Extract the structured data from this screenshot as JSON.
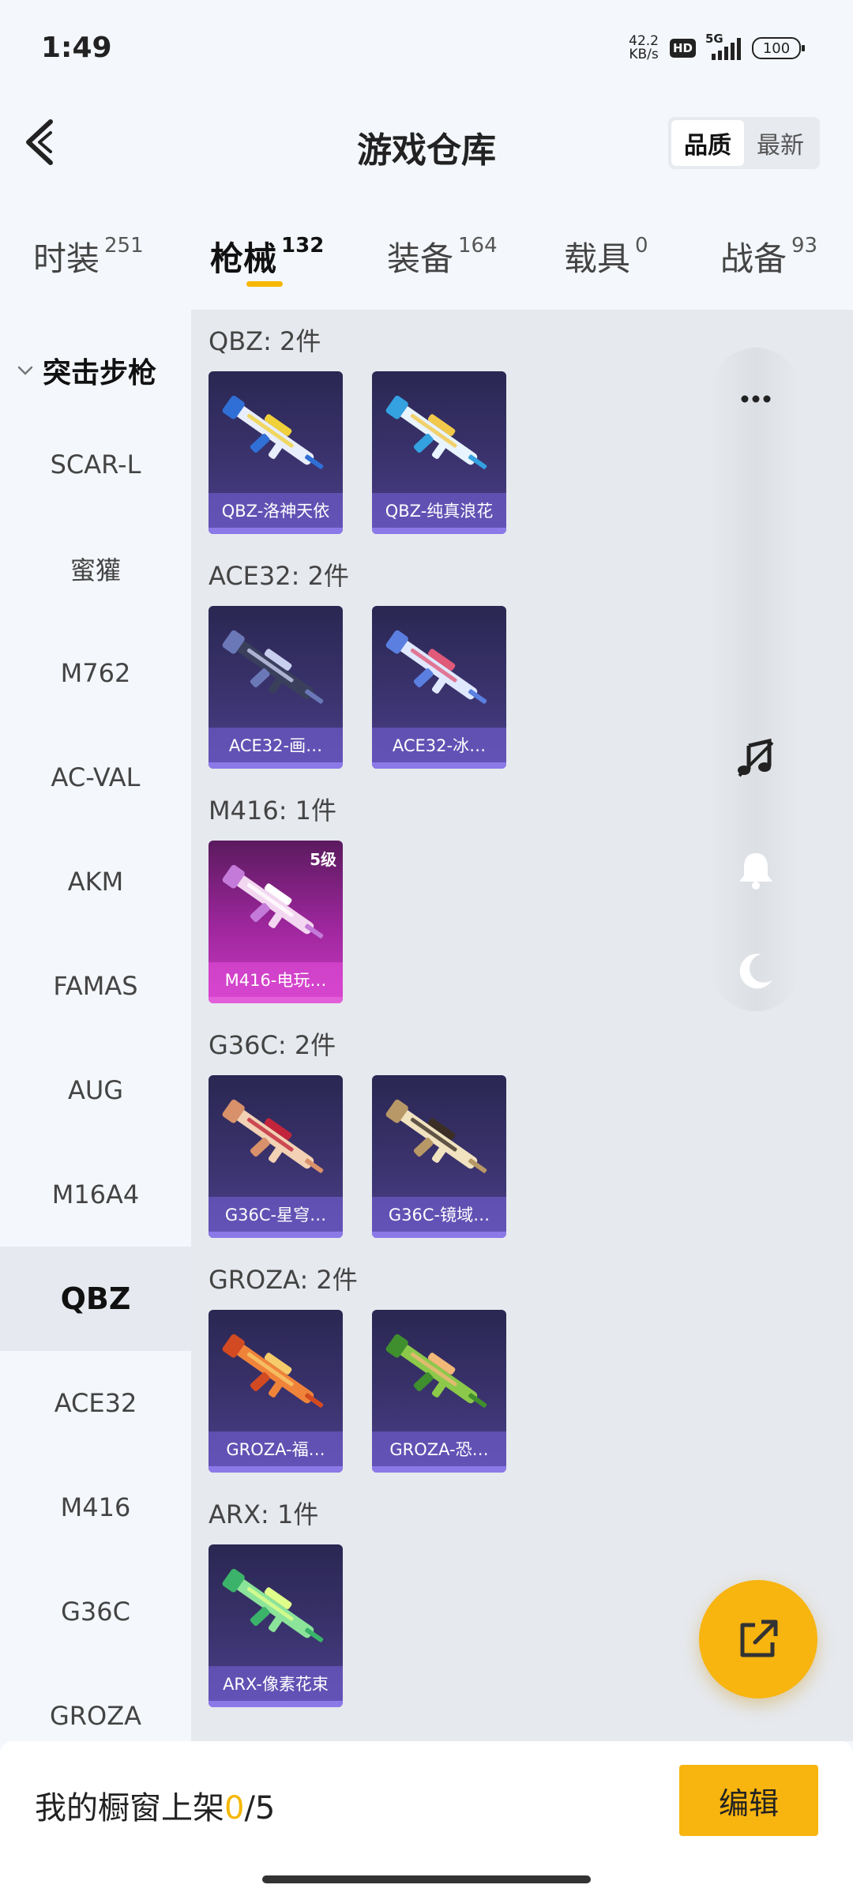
{
  "status": {
    "time": "1:49",
    "net_speed_value": "42.2",
    "net_speed_unit": "KB/s",
    "hd": "HD",
    "network": "5G",
    "battery": "100"
  },
  "header": {
    "title": "游戏仓库",
    "sort_options": [
      "品质",
      "最新"
    ],
    "sort_selected": "品质"
  },
  "tabs": [
    {
      "label": "时装",
      "count": "251"
    },
    {
      "label": "枪械",
      "count": "132"
    },
    {
      "label": "装备",
      "count": "164"
    },
    {
      "label": "载具",
      "count": "0"
    },
    {
      "label": "战备",
      "count": "93"
    }
  ],
  "active_tab": "枪械",
  "sidebar": {
    "group": "突击步枪",
    "items": [
      "SCAR-L",
      "蜜獾",
      "M762",
      "AC-VAL",
      "AKM",
      "FAMAS",
      "AUG",
      "M16A4",
      "QBZ",
      "ACE32",
      "M416",
      "G36C",
      "GROZA"
    ],
    "active_item": "QBZ"
  },
  "sections": [
    {
      "title": "QBZ: 2件",
      "items": [
        {
          "name": "QBZ-洛神天依",
          "colors": [
            "#e9eefc",
            "#2f6fd6",
            "#f0d13a"
          ]
        },
        {
          "name": "QBZ-纯真浪花",
          "colors": [
            "#e8f4ff",
            "#34a1e0",
            "#f2c84a"
          ]
        }
      ]
    },
    {
      "title": "ACE32: 2件",
      "items": [
        {
          "name": "ACE32-画…",
          "colors": [
            "#3a3f5c",
            "#6b78b8",
            "#c9d0ef"
          ]
        },
        {
          "name": "ACE32-冰…",
          "colors": [
            "#dfe8ff",
            "#5a7fe0",
            "#e05a7a"
          ]
        }
      ]
    },
    {
      "title": "M416: 1件",
      "items": [
        {
          "name": "M416-电玩…",
          "level": "5级",
          "rarity": "pink",
          "colors": [
            "#f3d7f1",
            "#c37ad8",
            "#ffffff"
          ]
        }
      ]
    },
    {
      "title": "G36C: 2件",
      "items": [
        {
          "name": "G36C-星穹…",
          "colors": [
            "#f2d1b4",
            "#d8916a",
            "#c2253b"
          ]
        },
        {
          "name": "G36C-镜域…",
          "colors": [
            "#f1e3c0",
            "#b89866",
            "#3b2f25"
          ]
        }
      ]
    },
    {
      "title": "GROZA: 2件",
      "items": [
        {
          "name": "GROZA-福…",
          "colors": [
            "#f0833a",
            "#d24a22",
            "#f6cc6a"
          ]
        },
        {
          "name": "GROZA-恐…",
          "colors": [
            "#8cc94a",
            "#3f8f2e",
            "#f2b878"
          ]
        }
      ]
    },
    {
      "title": "ARX: 1件",
      "items": [
        {
          "name": "ARX-像素花束",
          "colors": [
            "#8be49a",
            "#3bb36a",
            "#e0ff8a"
          ]
        }
      ]
    }
  ],
  "float_panel_icons": [
    "more-icon",
    "music-off-icon",
    "bell-icon",
    "moon-icon"
  ],
  "bottom_bar": {
    "label": "我的橱窗上架",
    "count_used": "0",
    "count_total": "/5",
    "edit_label": "编辑"
  },
  "colors": {
    "accent": "#f8b40f",
    "card_bg": "#3b336e",
    "card_pink": "#c83ac0"
  }
}
